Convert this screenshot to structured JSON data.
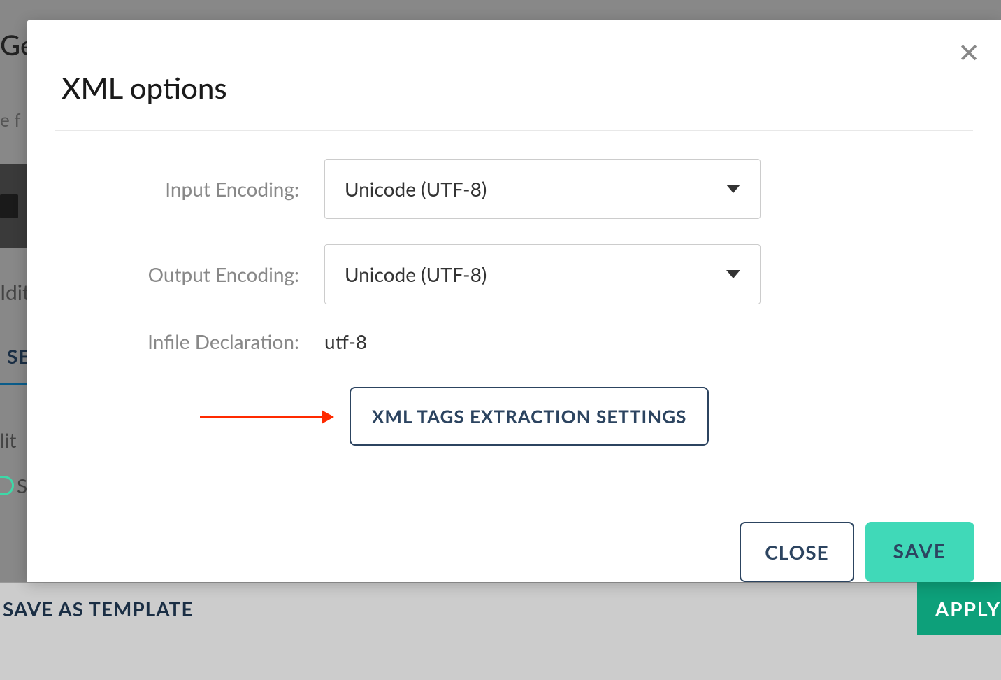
{
  "background": {
    "title_fragment": "Get",
    "ef_fragment": "e f",
    "idit_fragment": "Idit",
    "se_fragment": "SE",
    "lit_fragment": "lit",
    "s_fragment": "S",
    "save_template": "SAVE AS TEMPLATE",
    "apply": "APPLY",
    "right_x": "✕"
  },
  "modal": {
    "title": "XML options",
    "close_icon": "✕",
    "fields": {
      "input_encoding": {
        "label": "Input Encoding:",
        "value": "Unicode (UTF-8)"
      },
      "output_encoding": {
        "label": "Output Encoding:",
        "value": "Unicode (UTF-8)"
      },
      "infile_declaration": {
        "label": "Infile Declaration:",
        "value": "utf-8"
      }
    },
    "extraction_button": "XML TAGS EXTRACTION SETTINGS",
    "footer": {
      "close": "CLOSE",
      "save": "SAVE"
    }
  }
}
